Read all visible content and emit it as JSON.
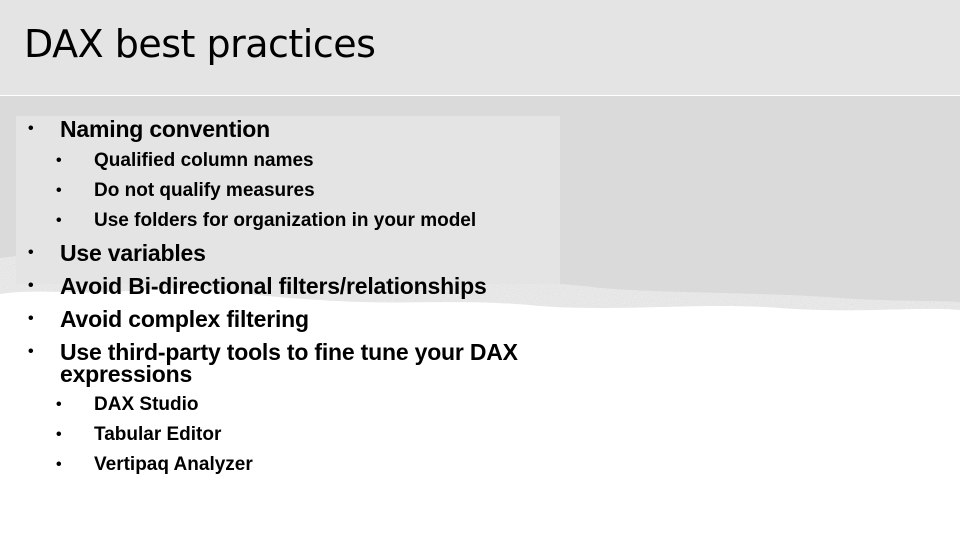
{
  "slide": {
    "title": "DAX best practices",
    "colors": {
      "title_band": "#e4e4e4",
      "body_band": "#dadada",
      "inner_box": "#e4e4e4",
      "background": "#ffffff",
      "text": "#000000"
    },
    "bullet_glyph": "•",
    "items": [
      {
        "text": "Naming convention",
        "children": [
          "Qualified column names",
          "Do not qualify measures",
          "Use folders for organization in your model"
        ]
      },
      {
        "text": "Use variables",
        "children": []
      },
      {
        "text": "Avoid Bi-directional filters/relationships",
        "children": []
      },
      {
        "text": "Avoid complex filtering",
        "children": []
      },
      {
        "text": "Use third-party tools to fine tune your DAX",
        "text_cont": "expressions",
        "children": [
          "DAX Studio",
          "Tabular Editor",
          "Vertipaq Analyzer"
        ]
      }
    ]
  }
}
